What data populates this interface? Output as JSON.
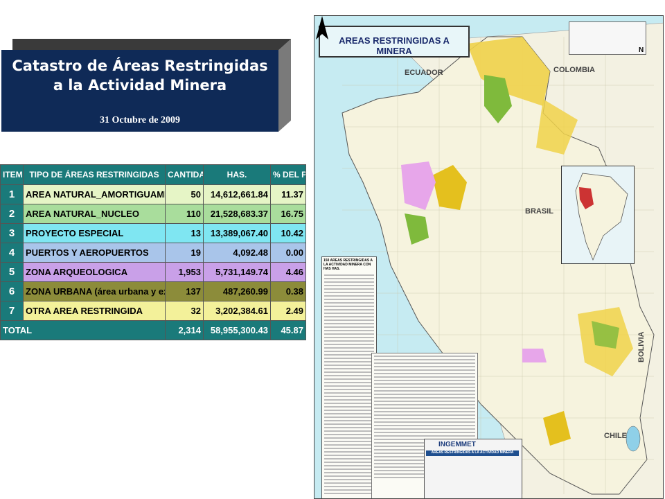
{
  "title": {
    "line1": "Catastro de Áreas Restringidas",
    "line2": "a la Actividad Minera",
    "date": "31 Octubre  de 2009"
  },
  "table": {
    "headers": [
      "ITEM",
      "TIPO DE ÁREAS RESTRINGIDAS",
      "CANTIDAD",
      "HAS.",
      "% DEL PERÚ"
    ],
    "rows": [
      {
        "item": "1",
        "tipo": "AREA NATURAL_AMORTIGUAMIENTO",
        "cantidad": "50",
        "has": "14,612,661.84",
        "pct": "11.37",
        "color": "#e6f5c6"
      },
      {
        "item": "2",
        "tipo": "AREA NATURAL_NUCLEO",
        "cantidad": "110",
        "has": "21,528,683.37",
        "pct": "16.75",
        "color": "#a9dd9c"
      },
      {
        "item": "3",
        "tipo": "PROYECTO ESPECIAL",
        "cantidad": "13",
        "has": "13,389,067.40",
        "pct": "10.42",
        "color": "#7fe6f2"
      },
      {
        "item": "4",
        "tipo": "PUERTOS Y AEROPUERTOS",
        "cantidad": "19",
        "has": "4,092.48",
        "pct": "0.00",
        "color": "#a9c5ea"
      },
      {
        "item": "5",
        "tipo": "ZONA ARQUEOLOGICA",
        "cantidad": "1,953",
        "has": "5,731,149.74",
        "pct": "4.46",
        "color": "#c9a0e8"
      },
      {
        "item": "6",
        "tipo": "ZONA URBANA (área urbana y expansión)",
        "cantidad": "137",
        "has": "487,260.99",
        "pct": "0.38",
        "color": "#8c8c3a"
      },
      {
        "item": "7",
        "tipo": "OTRA AREA RESTRINGIDA",
        "cantidad": "32",
        "has": "3,202,384.61",
        "pct": "2.49",
        "color": "#f3f19a"
      }
    ],
    "total": {
      "label": "TOTAL",
      "cantidad": "2,314",
      "has": "58,955,300.43",
      "pct": "45.87"
    }
  },
  "map": {
    "title": "AREAS RESTRINGIDAS A MINERA",
    "north": "N",
    "countries": [
      "ECUADOR",
      "COLOMBIA",
      "BRASIL",
      "BOLIVIA",
      "CHILE"
    ],
    "legend_header": "150 AREAS RESTRINGIDAS A LA ACTIVIDAD MINERA CON HAS HAS.",
    "ingemmet": "INGEMMET",
    "ingemmet_sub": "AREAS RESTRINGIDAS A LA ACTIVIDAD MINERA",
    "colors": {
      "sea": "#c6ebf2",
      "land": "#f6f3de",
      "amortiguamiento": "#f0d24a",
      "nucleo": "#e4c01e",
      "proyecto": "#e7a6ea",
      "green": "#7fba3c"
    }
  }
}
